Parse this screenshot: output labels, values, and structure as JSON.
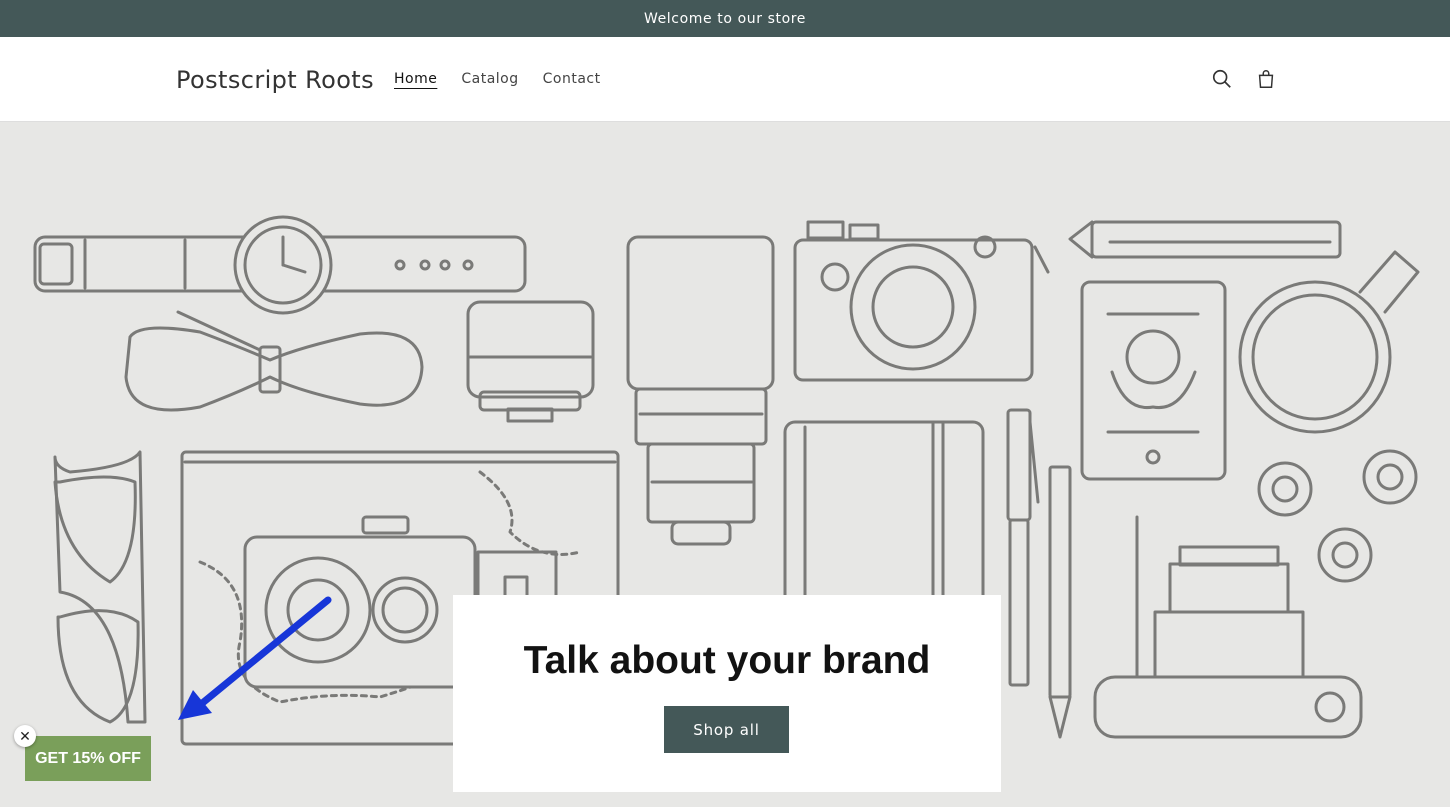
{
  "announcement": {
    "text": "Welcome to our store"
  },
  "header": {
    "logo": "Postscript Roots",
    "nav": [
      {
        "label": "Home",
        "active": true
      },
      {
        "label": "Catalog",
        "active": false
      },
      {
        "label": "Contact",
        "active": false
      }
    ],
    "icons": [
      "search-icon",
      "cart-icon"
    ]
  },
  "hero": {
    "title": "Talk about your brand",
    "button_label": "Shop all"
  },
  "promo": {
    "label": "GET 15% OFF",
    "close_glyph": "✕"
  },
  "colors": {
    "accent": "#445858",
    "promo": "#7a9f5a",
    "hero_bg": "#e7e7e5",
    "annotation_arrow": "#1736d8"
  }
}
